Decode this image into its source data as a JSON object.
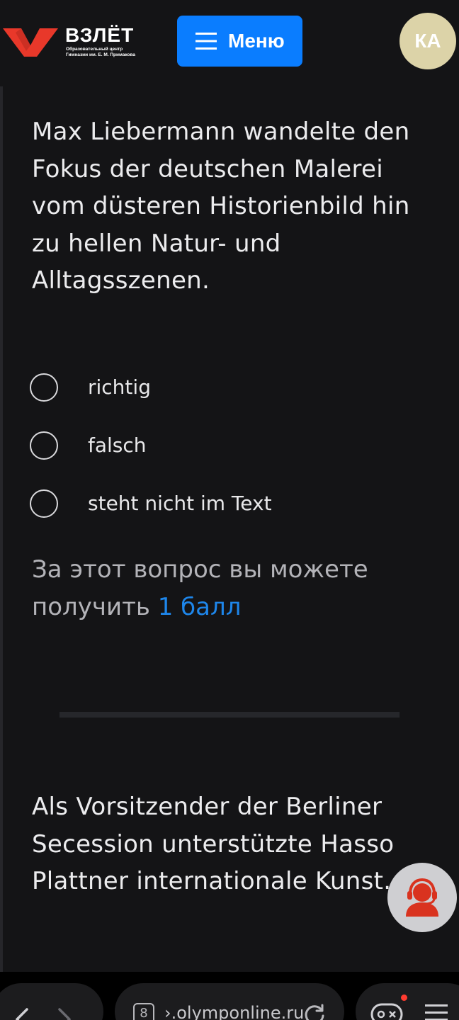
{
  "header": {
    "logo_title": "ВЗЛЁТ",
    "logo_subtitle": "Образовательный центр\nГимназии им. Е. М. Примакова",
    "menu_label": "Меню",
    "avatar_initials": "КА",
    "colors": {
      "logo_red": "#e8382a",
      "menu_blue": "#0a7dff",
      "avatar_bg": "#dcd3a8"
    }
  },
  "question_1": {
    "text": "Max Liebermann wandelte den Fokus der deutschen Malerei vom düsteren Historienbild hin zu hellen Natur- und Alltagsszenen.",
    "options": [
      {
        "label": "richtig",
        "selected": false
      },
      {
        "label": "falsch",
        "selected": false
      },
      {
        "label": "steht nicht im Text",
        "selected": false
      }
    ],
    "points_prefix": "За этот вопрос вы можете получить",
    "points_value": "1 балл"
  },
  "question_2": {
    "text": "Als Vorsitzender der Berliner Secession unterstützte Hasso Plattner internationale Kunst."
  },
  "support_button": {
    "icon": "support-headset-icon"
  },
  "browser": {
    "tab_count": "8",
    "url": "›.olymponline.ru",
    "icons": [
      "back-icon",
      "forward-icon",
      "reload-icon",
      "game-icon",
      "hamburger-icon"
    ]
  }
}
